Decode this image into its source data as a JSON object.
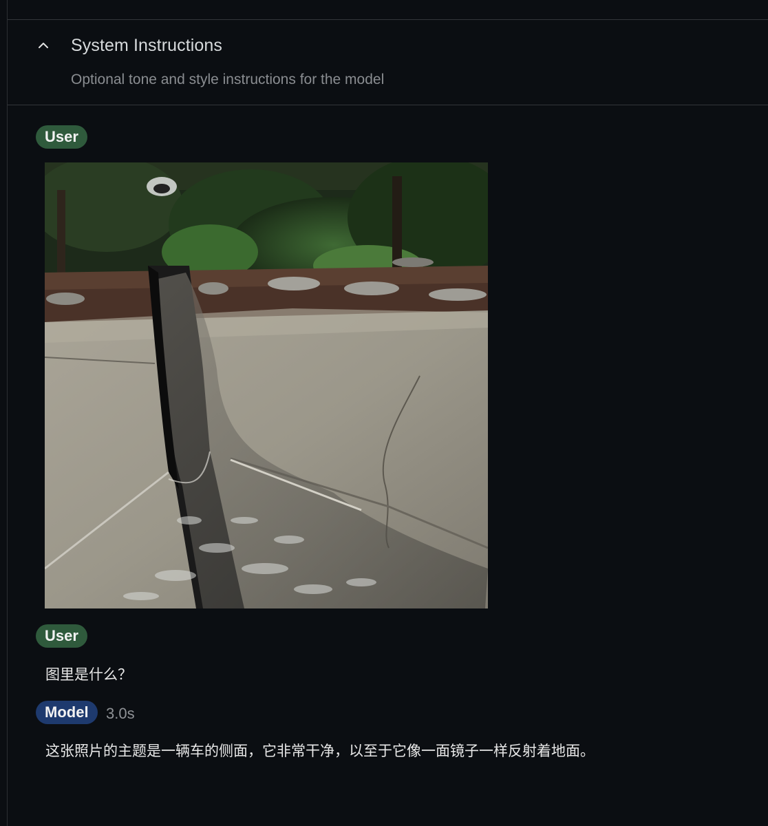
{
  "system_instructions": {
    "title": "System Instructions",
    "subtitle": "Optional tone and style instructions for the model",
    "toggle_icon": "chevron-up-icon"
  },
  "conversation": [
    {
      "role_label": "User",
      "kind": "image",
      "image_description": "car-side-mirror-reflection-photo"
    },
    {
      "role_label": "User",
      "kind": "text",
      "text": "图里是什么？"
    },
    {
      "role_label": "Model",
      "kind": "text",
      "timing": "3.0s",
      "text": "这张照片的主题是一辆车的侧面，它非常干净，以至于它像一面镜子一样反射着地面。"
    }
  ],
  "colors": {
    "background": "#0b0e12",
    "user_badge": "#2f5a3c",
    "model_badge": "#1e3a6e",
    "divider": "#33363a"
  }
}
